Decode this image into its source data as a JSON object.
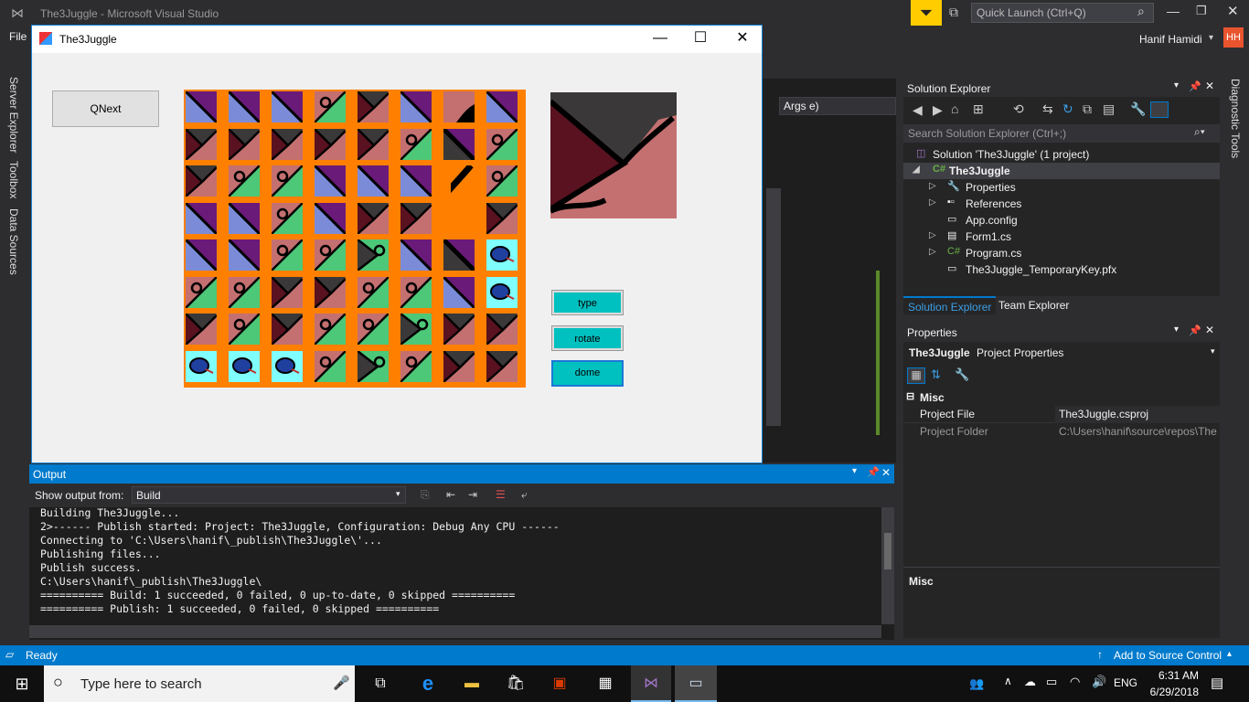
{
  "vs": {
    "title": "The3Juggle - Microsoft Visual Studio",
    "menu_file": "File",
    "quick_launch": "Quick Launch (Ctrl+Q)",
    "user": "Hanif Hamidi",
    "user_initials": "HH",
    "left_tabs": [
      "Server Explorer",
      "Toolbox",
      "Data Sources"
    ],
    "right_tab": "Diagnostic Tools",
    "editor_snippet": "Args e)"
  },
  "form": {
    "title": "The3Juggle",
    "qnext_label": "QNext",
    "type_label": "type",
    "rotate_label": "rotate",
    "done_label": "dome",
    "board": {
      "rows": 8,
      "cols": 8,
      "tiles": [
        [
          "purple",
          "blue",
          "purple",
          "scissor",
          "dark",
          "purple",
          "pinkhole",
          "blue"
        ],
        [
          "dark",
          "dark",
          "dark",
          "dark",
          "dark",
          "scissor",
          "slash",
          "scissor"
        ],
        [
          "dark",
          "scissor",
          "scissor",
          "purple",
          "purple",
          "purple",
          "slashb",
          "scissor"
        ],
        [
          "blue",
          "blue",
          "scissor",
          "blue",
          "dark",
          "dark",
          "empty",
          "dark"
        ],
        [
          "purple",
          "purple",
          "scissor",
          "scissor",
          "scissordark",
          "blue",
          "slash",
          "mouse"
        ],
        [
          "scissor",
          "scissor",
          "dark",
          "dark",
          "scissor",
          "scissor",
          "purple",
          "mouse"
        ],
        [
          "dark",
          "scissor",
          "dark",
          "scissor",
          "scissor",
          "scissordark",
          "dark",
          "dark"
        ],
        [
          "mouse",
          "mouse",
          "mouse",
          "scissor",
          "scissordark",
          "scissor",
          "dark",
          "dark"
        ]
      ]
    }
  },
  "solution_explorer": {
    "title": "Solution Explorer",
    "search_placeholder": "Search Solution Explorer (Ctrl+;)",
    "items": [
      {
        "label": "Solution 'The3Juggle' (1 project)",
        "icon": "solution-icon"
      },
      {
        "label": "The3Juggle",
        "icon": "csharp-project-icon"
      },
      {
        "label": "Properties",
        "icon": "wrench-icon"
      },
      {
        "label": "References",
        "icon": "references-icon"
      },
      {
        "label": "App.config",
        "icon": "config-icon"
      },
      {
        "label": "Form1.cs",
        "icon": "form-icon"
      },
      {
        "label": "Program.cs",
        "icon": "csharp-file-icon"
      },
      {
        "label": "The3Juggle_TemporaryKey.pfx",
        "icon": "key-file-icon"
      }
    ],
    "tabs": [
      "Solution Explorer",
      "Team Explorer"
    ]
  },
  "properties": {
    "title": "Properties",
    "object_name": "The3Juggle",
    "object_type": "Project Properties",
    "category": "Misc",
    "rows": [
      {
        "name": "Project File",
        "value": "The3Juggle.csproj"
      },
      {
        "name": "Project Folder",
        "value": "C:\\Users\\hanif\\source\\repos\\The"
      }
    ],
    "description_title": "Misc"
  },
  "output": {
    "title": "Output",
    "show_from_label": "Show output from:",
    "source": "Build",
    "lines": [
      "Building The3Juggle...",
      "2>------ Publish started: Project: The3Juggle, Configuration: Debug Any CPU ------",
      "Connecting to 'C:\\Users\\hanif\\_publish\\The3Juggle\\'...",
      "Publishing files...",
      "Publish success.",
      "C:\\Users\\hanif\\_publish\\The3Juggle\\",
      "========== Build: 1 succeeded, 0 failed, 0 up-to-date, 0 skipped ==========",
      "========== Publish: 1 succeeded, 0 failed, 0 skipped =========="
    ]
  },
  "status": {
    "ready": "Ready",
    "source_control": "Add to Source Control"
  },
  "taskbar": {
    "search_placeholder": "Type here to search",
    "language": "ENG",
    "time": "6:31 AM",
    "date": "6/29/2018"
  },
  "colors": {
    "vs_blue": "#007acc",
    "board_orange": "#ff8000",
    "button_cyan": "#00c0c0"
  }
}
